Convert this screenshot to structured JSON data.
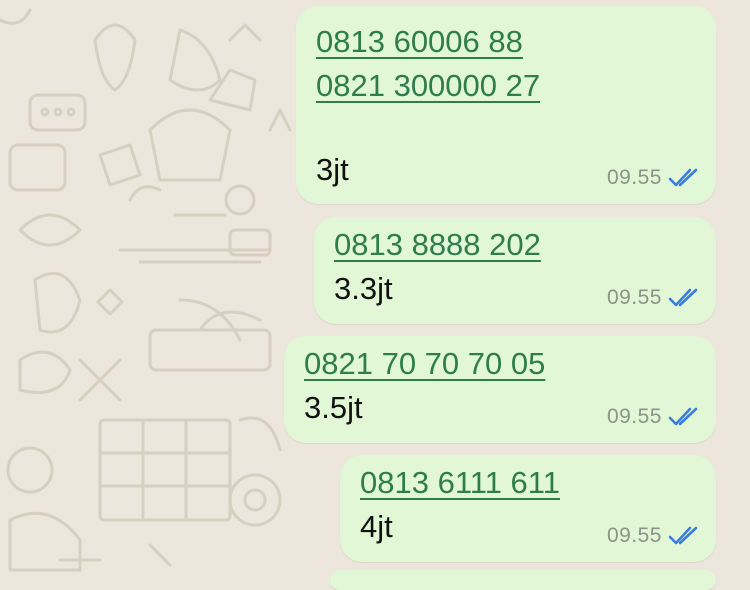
{
  "colors": {
    "background": "#ece6dd",
    "bubble": "#e1f7d5",
    "link": "#2f7d4a",
    "text": "#111111",
    "time": "#8a9488",
    "read_ticks": "#3b7ddd"
  },
  "messages": [
    {
      "phones": [
        "0813 60006 88",
        "0821 300000 27"
      ],
      "amount": "3jt",
      "time": "09.55",
      "status_icon": "double-check-read-icon"
    },
    {
      "phones": [
        "0813 8888 202"
      ],
      "amount": "3.3jt",
      "time": "09.55",
      "status_icon": "double-check-read-icon"
    },
    {
      "phones": [
        "0821 70 70 70 05"
      ],
      "amount": "3.5jt",
      "time": "09.55",
      "status_icon": "double-check-read-icon"
    },
    {
      "phones": [
        "0813 6111 611"
      ],
      "amount": "4jt",
      "time": "09.55",
      "status_icon": "double-check-read-icon"
    }
  ]
}
